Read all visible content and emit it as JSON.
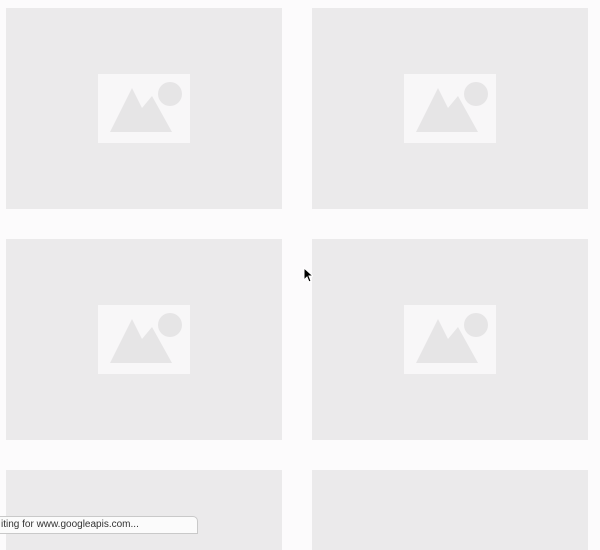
{
  "grid": {
    "cards": [
      {
        "icon": "image-placeholder-icon"
      },
      {
        "icon": "image-placeholder-icon"
      },
      {
        "icon": "image-placeholder-icon"
      },
      {
        "icon": "image-placeholder-icon"
      },
      {
        "icon": "image-placeholder-icon"
      },
      {
        "icon": "image-placeholder-icon"
      }
    ]
  },
  "status_bar": {
    "text": "iting for www.googleapis.com..."
  },
  "cursor": {
    "icon": "mouse-pointer-icon"
  },
  "colors": {
    "page_background": "#fcfbfc",
    "card_background": "#ebeaeb",
    "placeholder_background": "#f8f7f8",
    "placeholder_glyph": "#e6e5e6"
  }
}
